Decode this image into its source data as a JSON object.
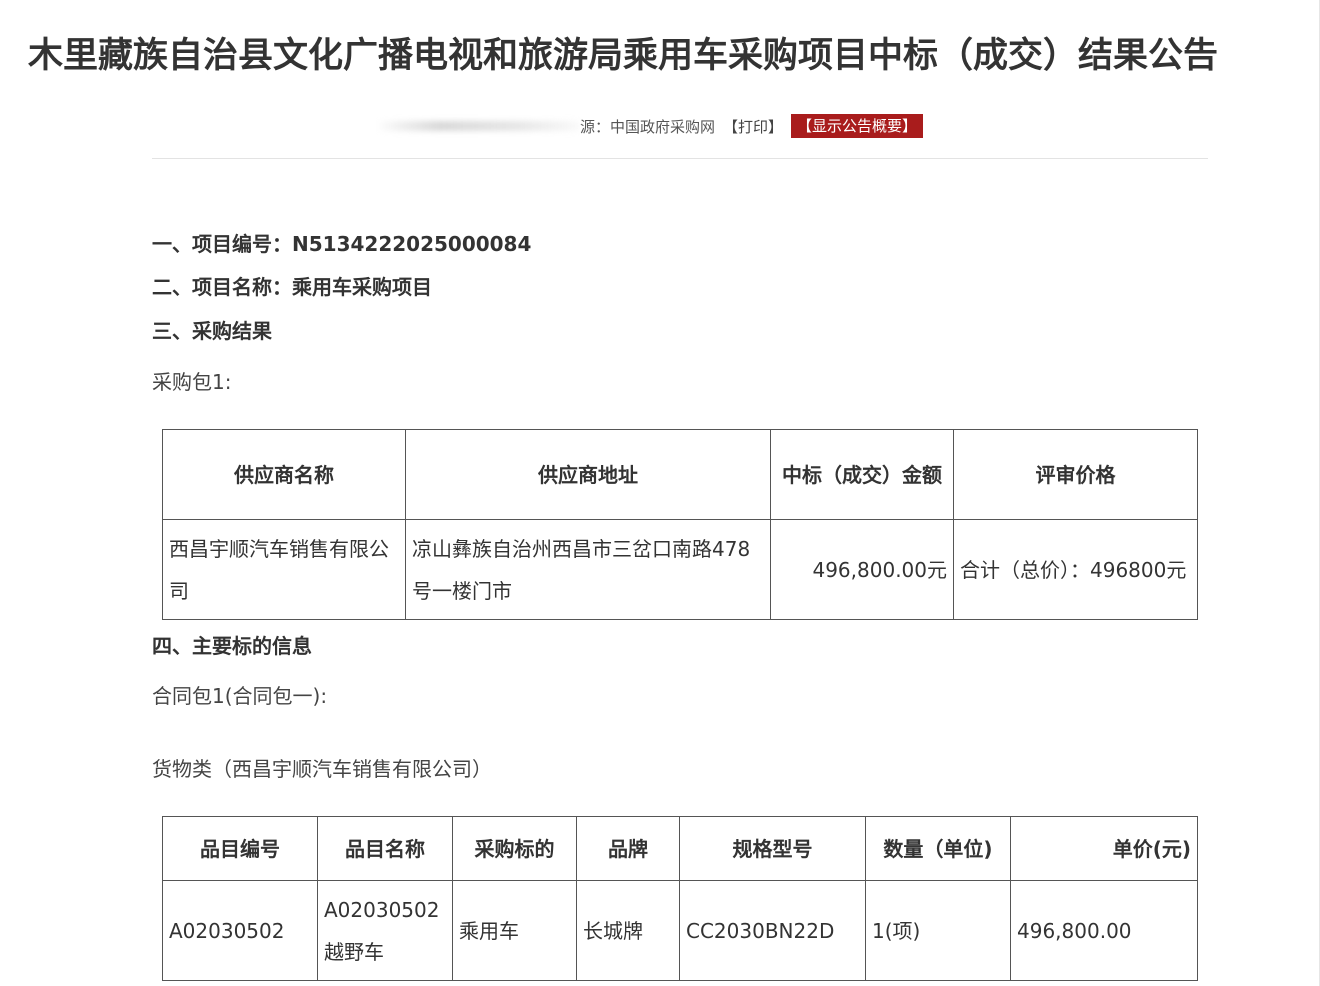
{
  "title": "木里藏族自治县文化广播电视和旅游局乘用车采购项目中标（成交）结果公告",
  "meta": {
    "source_label": "源：",
    "source_value": "中国政府采购网",
    "print": "【打印】",
    "summary_button": "【显示公告概要】"
  },
  "sections": {
    "project_no": "一、项目编号：N5134222025000084",
    "project_name": "二、项目名称：乘用车采购项目",
    "result": "三、采购结果",
    "package": "采购包1:",
    "main_info": "四、主要标的信息",
    "contract_package": "合同包1(合同包一):",
    "goods": "货物类（西昌宇顺汽车销售有限公司）"
  },
  "result_table": {
    "headers": [
      "供应商名称",
      "供应商地址",
      "中标（成交）金额",
      "评审价格"
    ],
    "rows": [
      [
        "西昌宇顺汽车销售有限公司",
        "凉山彝族自治州西昌市三岔口南路478号一楼门市",
        "496,800.00元",
        "合计（总价）：496800元"
      ]
    ]
  },
  "goods_table": {
    "headers": [
      "品目编号",
      "品目名称",
      "采购标的",
      "品牌",
      "规格型号",
      "数量（单位)",
      "单价(元)"
    ],
    "rows": [
      [
        "A02030502",
        "A02030502越野车",
        "乘用车",
        "长城牌",
        "CC2030BN22D",
        "1(项)",
        "496,800.00"
      ]
    ]
  }
}
